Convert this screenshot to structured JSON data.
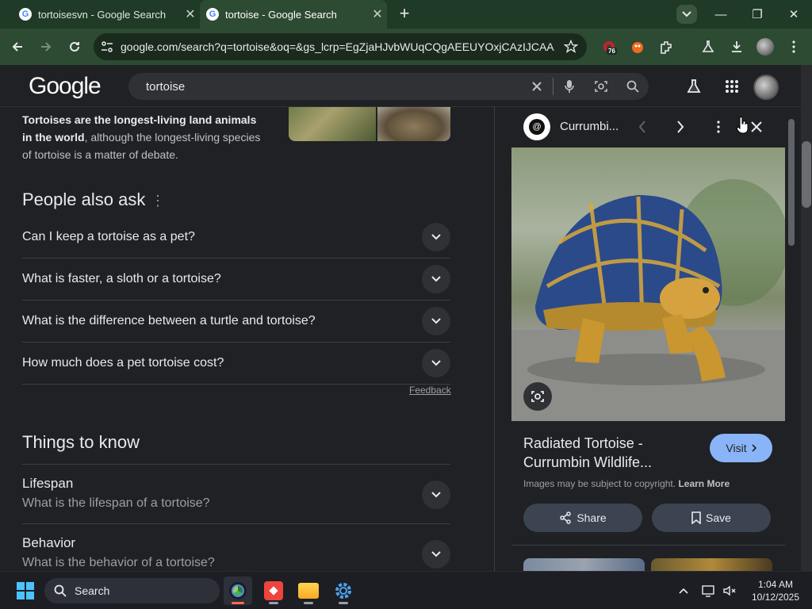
{
  "browser": {
    "tabs": [
      {
        "title": "tortoisesvn - Google Search",
        "active": false
      },
      {
        "title": "tortoise - Google Search",
        "active": true
      }
    ],
    "address": "google.com/search?q=tortoise&oq=&gs_lcrp=EgZjaHJvbWUqCQgAEEUYOxjCAzIJCAA...",
    "extension_badge": "76"
  },
  "google": {
    "logo": "Google",
    "query": "tortoise"
  },
  "knowledge": {
    "bold": "Tortoises are the longest-living land animals in the world",
    "rest": ", although the longest-living species of tortoise is a matter of debate."
  },
  "people_also_ask": {
    "title": "People also ask",
    "questions": [
      "Can I keep a tortoise as a pet?",
      "What is faster, a sloth or a tortoise?",
      "What is the difference between a turtle and tortoise?",
      "How much does a pet tortoise cost?"
    ],
    "feedback": "Feedback"
  },
  "things_to_know": {
    "title": "Things to know",
    "items": [
      {
        "heading": "Lifespan",
        "sub": "What is the lifespan of a tortoise?"
      },
      {
        "heading": "Behavior",
        "sub": "What is the behavior of a tortoise?"
      }
    ]
  },
  "panel": {
    "source": "Currumbi...",
    "title_line1": "Radiated Tortoise -",
    "title_line2": "Currumbin Wildlife...",
    "visit": "Visit",
    "copyright": "Images may be subject to copyright.",
    "learn_more": "Learn More",
    "share": "Share",
    "save": "Save"
  },
  "taskbar": {
    "search": "Search",
    "time": "1:04 AM",
    "date": "10/12/2025"
  },
  "colors": {
    "tab_bg": "#1f3a26",
    "toolbar_bg": "#2d4a33",
    "page_bg": "#202124",
    "visit_button": "#8ab4f8"
  }
}
